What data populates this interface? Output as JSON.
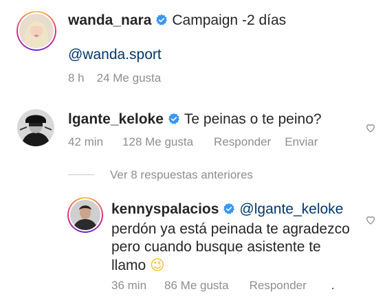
{
  "comments": [
    {
      "username": "wanda_nara",
      "text": "Campaign -2 días",
      "mention": "@wanda.sport",
      "time": "8 h",
      "likes": "24 Me gusta"
    },
    {
      "username": "lgante_keloke",
      "text": "Te peinas o te peino?",
      "time": "42 min",
      "likes": "128 Me gusta",
      "reply_label": "Responder",
      "send_label": "Enviar",
      "view_replies": "Ver 8 respuestas anteriores"
    },
    {
      "username": "kennyspalacios",
      "mention": "@lgante_keloke",
      "text_line1": "perdón ya está peinada te agradezco",
      "text_line2": "pero cuando busque asistente te",
      "text_line3": "llamo",
      "emoji": "😉",
      "time": "36 min",
      "likes": "86 Me gusta",
      "reply_label": "Responder",
      "more": "."
    }
  ],
  "colors": {
    "verified": "#3897f0",
    "mention": "#00376b",
    "meta": "#8e8e8e"
  }
}
